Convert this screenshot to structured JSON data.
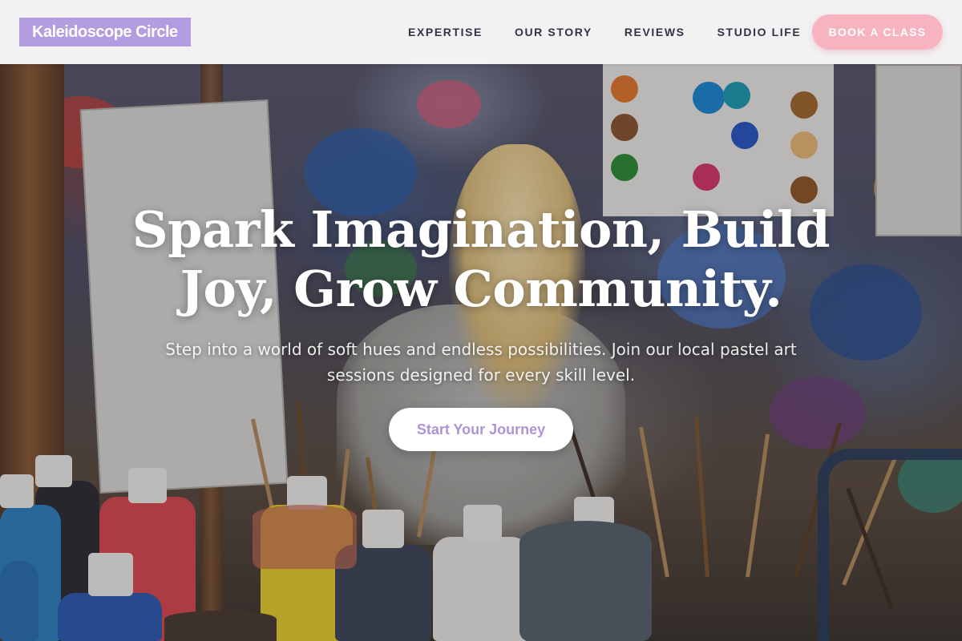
{
  "brand": {
    "name": "Kaleidoscope Circle",
    "logo_color": "#b39ce0"
  },
  "nav": {
    "items": [
      {
        "label": "EXPERTISE"
      },
      {
        "label": "OUR STORY"
      },
      {
        "label": "REVIEWS"
      },
      {
        "label": "STUDIO LIFE"
      }
    ],
    "cta_label": "BOOK A CLASS",
    "cta_color": "#f7b4c0"
  },
  "hero": {
    "title_line1": "Spark Imagination, Build",
    "title_line2": "Joy, Grow Community.",
    "subtitle": "Step into a world of soft hues and endless possibilities. Join our local pastel art sessions designed for every skill level.",
    "button_label": "Start Your Journey",
    "button_text_color": "#ab95d8",
    "background_image": "art-studio-child-painting-photo"
  },
  "colors": {
    "nav_text": "#2f3447",
    "header_bg": "#ffffff"
  }
}
